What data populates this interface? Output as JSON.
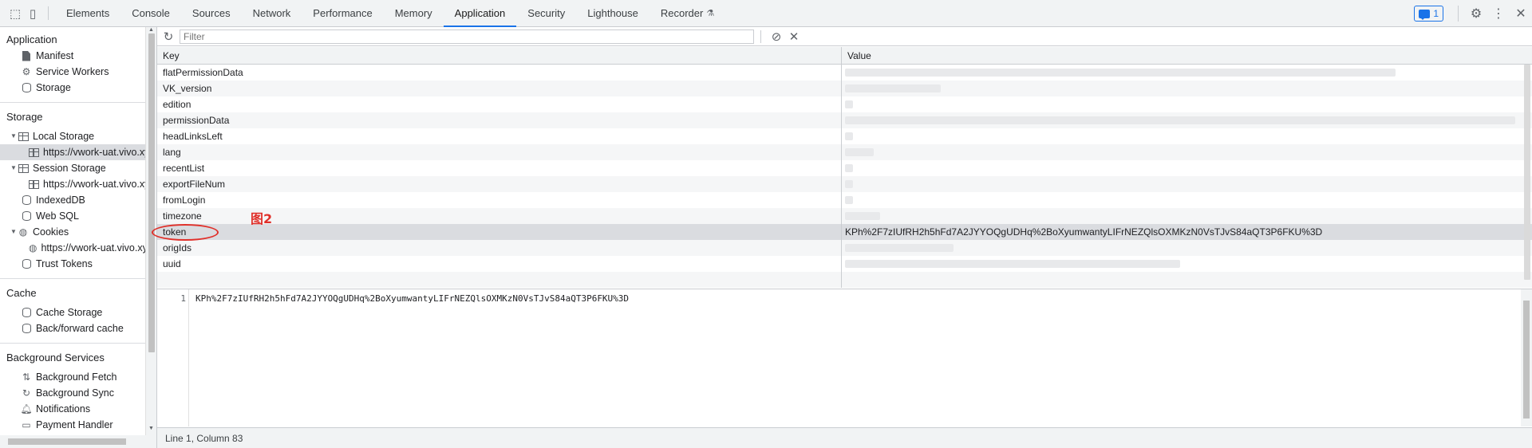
{
  "toolbar": {
    "tabs": [
      "Elements",
      "Console",
      "Sources",
      "Network",
      "Performance",
      "Memory",
      "Application",
      "Security",
      "Lighthouse",
      "Recorder"
    ],
    "active_tab": "Application",
    "issues_count": "1"
  },
  "sidebar": {
    "application_title": "Application",
    "application_items": [
      "Manifest",
      "Service Workers",
      "Storage"
    ],
    "storage_title": "Storage",
    "local_storage": "Local Storage",
    "local_storage_origin": "https://vwork-uat.vivo.xyz",
    "session_storage": "Session Storage",
    "session_storage_origin": "https://vwork-uat.vivo.xyz",
    "indexeddb": "IndexedDB",
    "websql": "Web SQL",
    "cookies": "Cookies",
    "cookies_origin": "https://vwork-uat.vivo.xyz",
    "trust_tokens": "Trust Tokens",
    "cache_title": "Cache",
    "cache_storage": "Cache Storage",
    "bfcache": "Back/forward cache",
    "background_title": "Background Services",
    "background_fetch": "Background Fetch",
    "background_sync": "Background Sync",
    "notifications": "Notifications",
    "payment_handler": "Payment Handler"
  },
  "filter": {
    "placeholder": "Filter"
  },
  "table": {
    "key_header": "Key",
    "value_header": "Value",
    "rows": [
      {
        "key": "flatPermissionData"
      },
      {
        "key": "VK_version"
      },
      {
        "key": "edition"
      },
      {
        "key": "permissionData"
      },
      {
        "key": "headLinksLeft"
      },
      {
        "key": "lang"
      },
      {
        "key": "recentList"
      },
      {
        "key": "exportFileNum"
      },
      {
        "key": "fromLogin"
      },
      {
        "key": "timezone"
      },
      {
        "key": "token",
        "value": "KPh%2F7zIUfRH2h5hFd7A2JYYOQgUDHq%2BoXyumwantyLIFrNEZQlsOXMKzN0VsTJvS84aQT3P6FKU%3D"
      },
      {
        "key": "origIds"
      },
      {
        "key": "uuid"
      }
    ]
  },
  "annotation": {
    "label": "图2"
  },
  "editor": {
    "line_number": "1",
    "content": "KPh%2F7zIUfRH2h5hFd7A2JYYOQgUDHq%2BoXyumwantyLIFrNEZQlsOXMKzN0VsTJvS84aQT3P6FKU%3D"
  },
  "status": {
    "text": "Line 1, Column 83"
  }
}
